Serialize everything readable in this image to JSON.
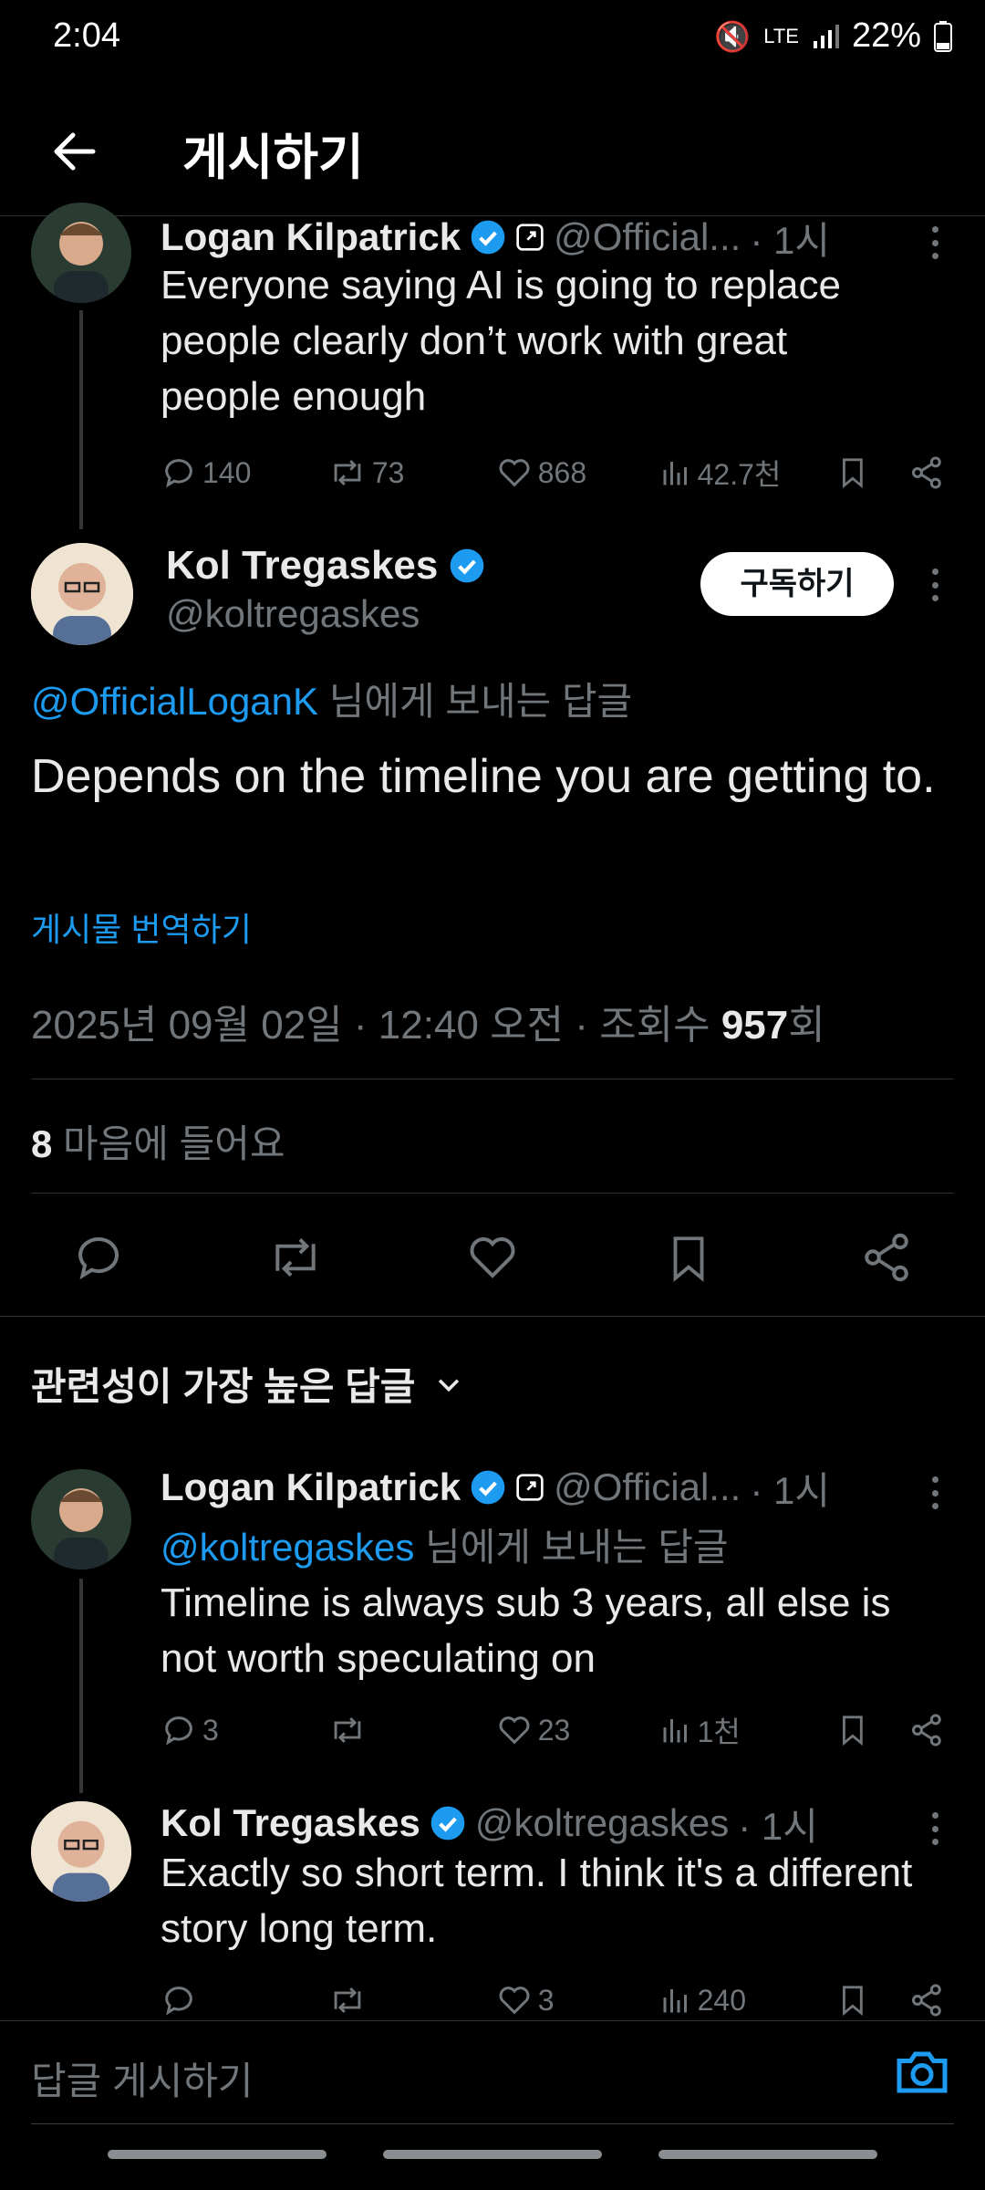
{
  "status_bar": {
    "time": "2:04",
    "battery": "22%",
    "network": "LTE"
  },
  "header": {
    "title": "게시하기"
  },
  "parent_tweet": {
    "name": "Logan Kilpatrick",
    "handle": "@Official...",
    "time": "· 1시",
    "text": "Everyone saying AI is going to replace people clearly don’t work with great people enough",
    "replies": "140",
    "retweets": "73",
    "likes": "868",
    "views": "42.7천"
  },
  "main_tweet": {
    "name": "Kol Tregaskes",
    "handle": "@koltregaskes",
    "subscribe_label": "구독하기",
    "reply_to_handle": "@OfficialLoganK",
    "reply_to_suffix": " 님에게 보내는 답글",
    "text": "Depends on the timeline you are getting to.",
    "translate_label": "게시물 번역하기",
    "timestamp": "2025년 09월 02일 · 12:40 오전 · 조회수 ",
    "views_count": "957",
    "views_suffix": "회",
    "likes_count": "8",
    "likes_label": " 마음에 들어요"
  },
  "sort": {
    "label": "관련성이 가장 높은 답글"
  },
  "replies": [
    {
      "name": "Logan Kilpatrick",
      "handle": "@Official...",
      "time": "· 1시",
      "reply_to_handle": "@koltregaskes",
      "reply_to_suffix": " 님에게 보내는 답글",
      "text": "Timeline is always sub 3 years, all else is not worth speculating on",
      "replies": "3",
      "retweets": "",
      "likes": "23",
      "views": "1천"
    },
    {
      "name": "Kol Tregaskes",
      "handle": "@koltregaskes",
      "time": "· 1시",
      "text": "Exactly so short term.  I think it's a different story long term.",
      "replies": "",
      "retweets": "",
      "likes": "3",
      "views": "240"
    }
  ],
  "composer": {
    "placeholder": "답글 게시하기"
  },
  "colors": {
    "accent": "#1d9bf0",
    "background": "#000000",
    "muted": "#71767b",
    "text": "#e7e9ea"
  }
}
